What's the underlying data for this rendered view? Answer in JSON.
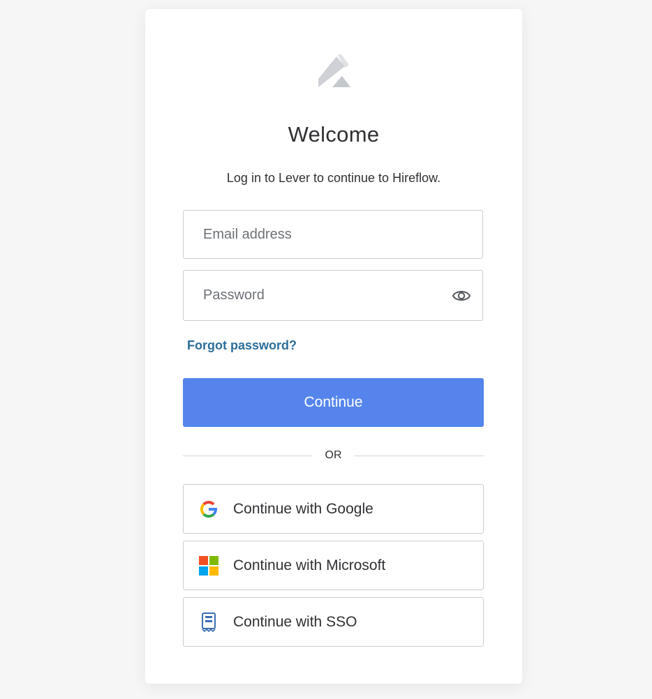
{
  "app": {
    "title": "Welcome",
    "subtitle": "Log in to Lever to continue to Hireflow."
  },
  "form": {
    "email": {
      "value": "",
      "placeholder": "Email address"
    },
    "password": {
      "value": "",
      "placeholder": "Password"
    },
    "forgot_label": "Forgot password?",
    "continue_label": "Continue"
  },
  "divider": {
    "label": "OR"
  },
  "social": {
    "google_label": "Continue with Google",
    "microsoft_label": "Continue with Microsoft",
    "sso_label": "Continue with SSO"
  },
  "icons": {
    "logo": "lever-logo-icon",
    "password_toggle": "eye-icon",
    "google": "google-icon",
    "microsoft": "microsoft-icon",
    "sso": "sso-badge-icon"
  },
  "colors": {
    "primary_button": "#5585ec",
    "link": "#2c6d9a",
    "text": "#2f3033",
    "border": "#c9ccd1",
    "background": "#f6f6f6"
  }
}
